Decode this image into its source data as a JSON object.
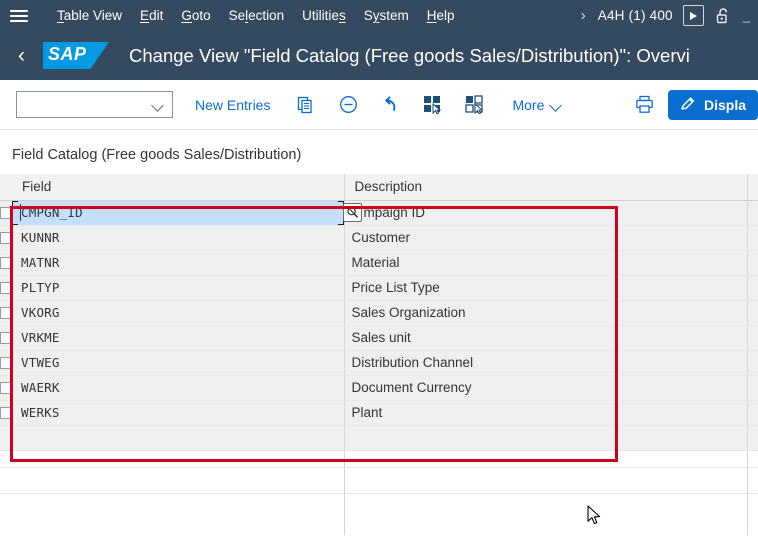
{
  "menubar": {
    "hamburger_icon": "hamburger-menu-icon",
    "items": [
      {
        "label": "Table View",
        "accel": "T"
      },
      {
        "label": "Edit",
        "accel": "E"
      },
      {
        "label": "Goto",
        "accel": "G"
      },
      {
        "label": "Selection",
        "accel": "l"
      },
      {
        "label": "Utilities",
        "accel": "s"
      },
      {
        "label": "System",
        "accel": "y"
      },
      {
        "label": "Help",
        "accel": "H"
      }
    ],
    "overflow_chevron": "›",
    "system_id": "A4H (1) 400",
    "execute_icon": "execute-play-icon",
    "lock_icon": "unlocked-padlock-icon",
    "tail": "_"
  },
  "shellbar": {
    "back_label": "‹",
    "logo_text": "SAP",
    "title": "Change View \"Field Catalog (Free goods Sales/Distribution)\": Overvi"
  },
  "toolbar": {
    "combo_value": "",
    "combo_placeholder": "",
    "new_entries_label": "New Entries",
    "copy_icon": "copy-as-icon",
    "delete_icon": "delete-minus-circle-icon",
    "undo_icon": "undo-arrow-icon",
    "select_all_icon": "select-all-icon",
    "deselect_all_icon": "deselect-all-icon",
    "more_label": "More",
    "print_icon": "print-icon",
    "display_change_label": "Displa",
    "display_change_icon": "edit-pencil-icon"
  },
  "content": {
    "section_title": "Field Catalog (Free goods Sales/Distribution)",
    "table": {
      "columns": [
        "",
        "Field",
        "Description",
        ""
      ],
      "rows": [
        {
          "field": "CMPGN_ID",
          "description": "mpaign ID",
          "active": true
        },
        {
          "field": "KUNNR",
          "description": "Customer",
          "active": false
        },
        {
          "field": "MATNR",
          "description": "Material",
          "active": false
        },
        {
          "field": "PLTYP",
          "description": "Price List Type",
          "active": false
        },
        {
          "field": "VKORG",
          "description": "Sales Organization",
          "active": false
        },
        {
          "field": "VRKME",
          "description": "Sales unit",
          "active": false
        },
        {
          "field": "VTWEG",
          "description": "Distribution Channel",
          "active": false
        },
        {
          "field": "WAERK",
          "description": "Document Currency",
          "active": false
        },
        {
          "field": "WERKS",
          "description": "Plant",
          "active": false
        },
        {
          "field": "",
          "description": "",
          "active": false
        }
      ],
      "value_help_icon": "value-help-search-icon"
    },
    "annotation": {
      "highlight_color": "#d0021b"
    }
  },
  "colors": {
    "shell_bg": "#354a5f",
    "accent_blue": "#0a6ed1",
    "logo_blue": "#039ae3",
    "active_row": "#c5dffa",
    "row_bg": "#efefef",
    "header_bg": "#f2f2f2"
  },
  "cursor": {
    "icon": "mouse-arrow-cursor"
  }
}
